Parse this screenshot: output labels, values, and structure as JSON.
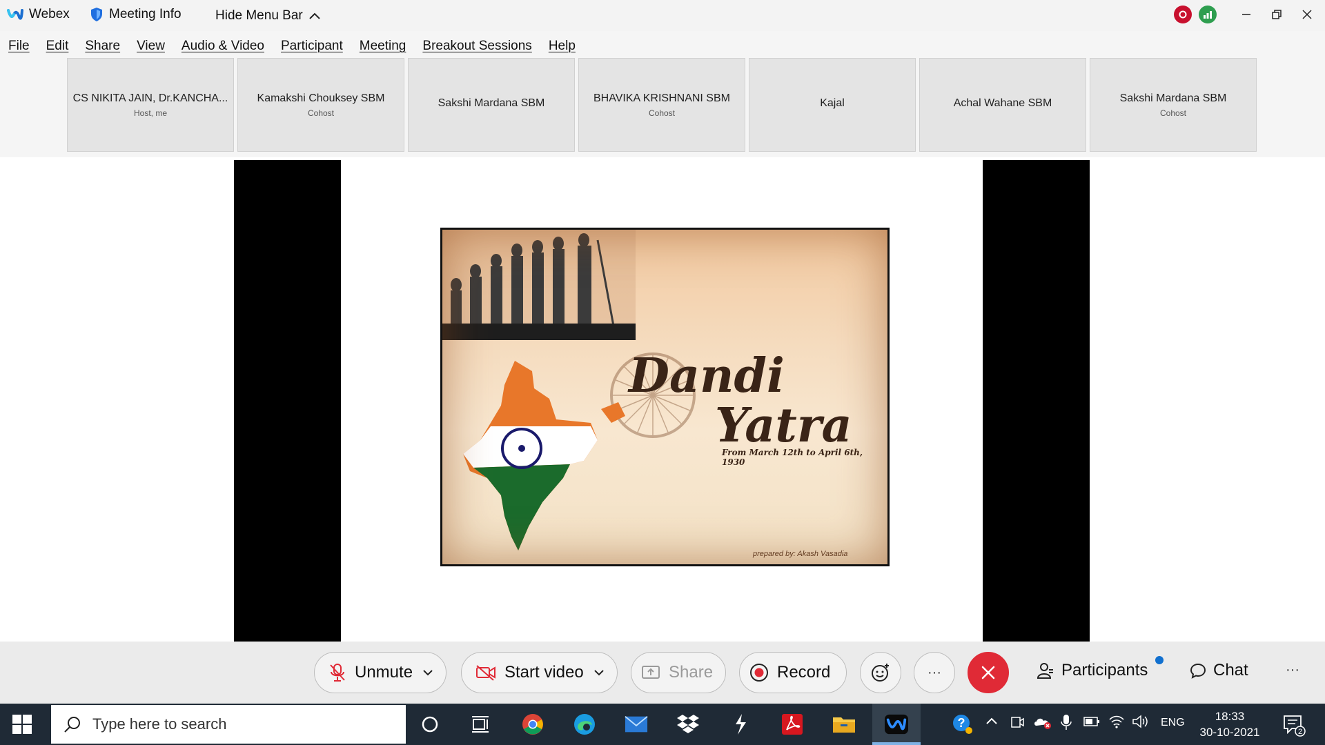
{
  "titlebar": {
    "app_name": "Webex",
    "meeting_info": "Meeting Info",
    "hide_menu": "Hide Menu Bar"
  },
  "menu": [
    "File",
    "Edit",
    "Share",
    "View",
    "Audio & Video",
    "Participant",
    "Meeting",
    "Breakout Sessions",
    "Help"
  ],
  "participants": [
    {
      "name": "CS NIKITA JAIN, Dr.KANCHA...",
      "role": "Host, me"
    },
    {
      "name": "Kamakshi Chouksey SBM",
      "role": "Cohost"
    },
    {
      "name": "Sakshi Mardana SBM",
      "role": ""
    },
    {
      "name": "BHAVIKA KRISHNANI SBM",
      "role": "Cohost"
    },
    {
      "name": "Kajal",
      "role": ""
    },
    {
      "name": "Achal Wahane SBM",
      "role": ""
    },
    {
      "name": "Sakshi Mardana SBM",
      "role": "Cohost"
    }
  ],
  "slide": {
    "title_line1": "Dandi",
    "title_line2": "Yatra",
    "subtitle": "From March 12th to April 6th, 1930",
    "credit": "prepared by: Akash Vasadia"
  },
  "controls": {
    "unmute": "Unmute",
    "start_video": "Start video",
    "share": "Share",
    "record": "Record",
    "more": "···",
    "participants": "Participants",
    "chat": "Chat",
    "overflow": "···"
  },
  "taskbar": {
    "search_placeholder": "Type here to search",
    "language": "ENG",
    "time": "18:33",
    "date": "30-10-2021",
    "notification_count": "2"
  },
  "colors": {
    "leave_red": "#e02a36",
    "accent_blue": "#1170cf",
    "taskbar_bg": "#1f2a36"
  }
}
